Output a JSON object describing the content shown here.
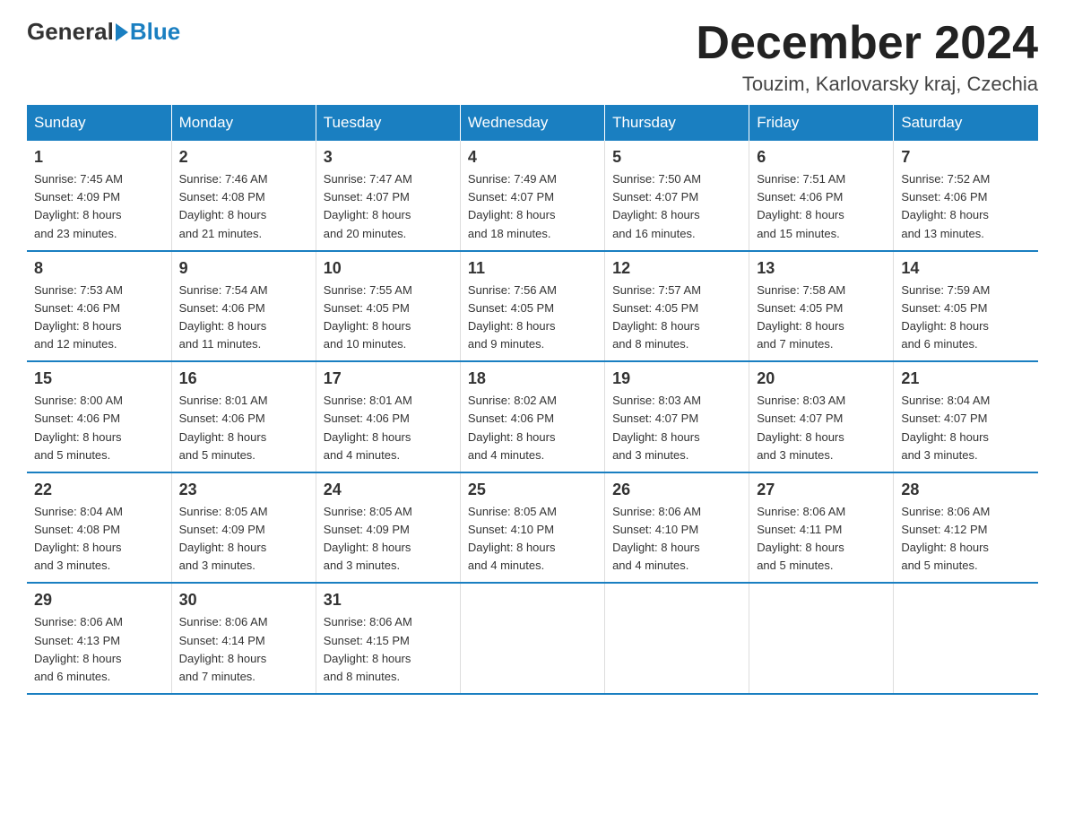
{
  "header": {
    "logo_general": "General",
    "logo_blue": "Blue",
    "month_title": "December 2024",
    "location": "Touzim, Karlovarsky kraj, Czechia"
  },
  "days_of_week": [
    "Sunday",
    "Monday",
    "Tuesday",
    "Wednesday",
    "Thursday",
    "Friday",
    "Saturday"
  ],
  "weeks": [
    [
      {
        "day": "1",
        "sunrise": "7:45 AM",
        "sunset": "4:09 PM",
        "daylight": "8 hours and 23 minutes."
      },
      {
        "day": "2",
        "sunrise": "7:46 AM",
        "sunset": "4:08 PM",
        "daylight": "8 hours and 21 minutes."
      },
      {
        "day": "3",
        "sunrise": "7:47 AM",
        "sunset": "4:07 PM",
        "daylight": "8 hours and 20 minutes."
      },
      {
        "day": "4",
        "sunrise": "7:49 AM",
        "sunset": "4:07 PM",
        "daylight": "8 hours and 18 minutes."
      },
      {
        "day": "5",
        "sunrise": "7:50 AM",
        "sunset": "4:07 PM",
        "daylight": "8 hours and 16 minutes."
      },
      {
        "day": "6",
        "sunrise": "7:51 AM",
        "sunset": "4:06 PM",
        "daylight": "8 hours and 15 minutes."
      },
      {
        "day": "7",
        "sunrise": "7:52 AM",
        "sunset": "4:06 PM",
        "daylight": "8 hours and 13 minutes."
      }
    ],
    [
      {
        "day": "8",
        "sunrise": "7:53 AM",
        "sunset": "4:06 PM",
        "daylight": "8 hours and 12 minutes."
      },
      {
        "day": "9",
        "sunrise": "7:54 AM",
        "sunset": "4:06 PM",
        "daylight": "8 hours and 11 minutes."
      },
      {
        "day": "10",
        "sunrise": "7:55 AM",
        "sunset": "4:05 PM",
        "daylight": "8 hours and 10 minutes."
      },
      {
        "day": "11",
        "sunrise": "7:56 AM",
        "sunset": "4:05 PM",
        "daylight": "8 hours and 9 minutes."
      },
      {
        "day": "12",
        "sunrise": "7:57 AM",
        "sunset": "4:05 PM",
        "daylight": "8 hours and 8 minutes."
      },
      {
        "day": "13",
        "sunrise": "7:58 AM",
        "sunset": "4:05 PM",
        "daylight": "8 hours and 7 minutes."
      },
      {
        "day": "14",
        "sunrise": "7:59 AM",
        "sunset": "4:05 PM",
        "daylight": "8 hours and 6 minutes."
      }
    ],
    [
      {
        "day": "15",
        "sunrise": "8:00 AM",
        "sunset": "4:06 PM",
        "daylight": "8 hours and 5 minutes."
      },
      {
        "day": "16",
        "sunrise": "8:01 AM",
        "sunset": "4:06 PM",
        "daylight": "8 hours and 5 minutes."
      },
      {
        "day": "17",
        "sunrise": "8:01 AM",
        "sunset": "4:06 PM",
        "daylight": "8 hours and 4 minutes."
      },
      {
        "day": "18",
        "sunrise": "8:02 AM",
        "sunset": "4:06 PM",
        "daylight": "8 hours and 4 minutes."
      },
      {
        "day": "19",
        "sunrise": "8:03 AM",
        "sunset": "4:07 PM",
        "daylight": "8 hours and 3 minutes."
      },
      {
        "day": "20",
        "sunrise": "8:03 AM",
        "sunset": "4:07 PM",
        "daylight": "8 hours and 3 minutes."
      },
      {
        "day": "21",
        "sunrise": "8:04 AM",
        "sunset": "4:07 PM",
        "daylight": "8 hours and 3 minutes."
      }
    ],
    [
      {
        "day": "22",
        "sunrise": "8:04 AM",
        "sunset": "4:08 PM",
        "daylight": "8 hours and 3 minutes."
      },
      {
        "day": "23",
        "sunrise": "8:05 AM",
        "sunset": "4:09 PM",
        "daylight": "8 hours and 3 minutes."
      },
      {
        "day": "24",
        "sunrise": "8:05 AM",
        "sunset": "4:09 PM",
        "daylight": "8 hours and 3 minutes."
      },
      {
        "day": "25",
        "sunrise": "8:05 AM",
        "sunset": "4:10 PM",
        "daylight": "8 hours and 4 minutes."
      },
      {
        "day": "26",
        "sunrise": "8:06 AM",
        "sunset": "4:10 PM",
        "daylight": "8 hours and 4 minutes."
      },
      {
        "day": "27",
        "sunrise": "8:06 AM",
        "sunset": "4:11 PM",
        "daylight": "8 hours and 5 minutes."
      },
      {
        "day": "28",
        "sunrise": "8:06 AM",
        "sunset": "4:12 PM",
        "daylight": "8 hours and 5 minutes."
      }
    ],
    [
      {
        "day": "29",
        "sunrise": "8:06 AM",
        "sunset": "4:13 PM",
        "daylight": "8 hours and 6 minutes."
      },
      {
        "day": "30",
        "sunrise": "8:06 AM",
        "sunset": "4:14 PM",
        "daylight": "8 hours and 7 minutes."
      },
      {
        "day": "31",
        "sunrise": "8:06 AM",
        "sunset": "4:15 PM",
        "daylight": "8 hours and 8 minutes."
      },
      null,
      null,
      null,
      null
    ]
  ],
  "labels": {
    "sunrise": "Sunrise:",
    "sunset": "Sunset:",
    "daylight": "Daylight:"
  }
}
